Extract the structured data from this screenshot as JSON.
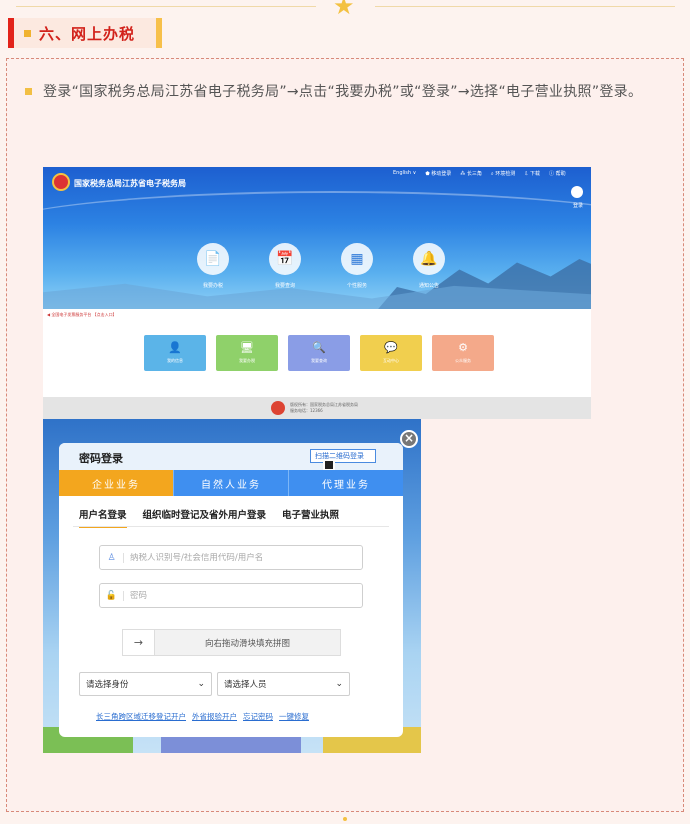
{
  "section": {
    "title": "六、网上办税"
  },
  "description": "登录“国家税务总局江苏省电子税务局”→点击“我要办税”或“登录”→选择“电子营业执照”登录。",
  "portal": {
    "site_title": "国家税务总局江苏省电子税务局",
    "top_nav": [
      "English ∨",
      "⬟ 移动登录",
      "⁂ 长三角",
      "⌕ 环境检测",
      "⇩ 下载",
      "ⓘ 帮助"
    ],
    "login_label": "登录",
    "circles": [
      {
        "icon": "📄",
        "label": "我要办税"
      },
      {
        "icon": "📅",
        "label": "我要查询"
      },
      {
        "icon": "▦",
        "label": "个性服务"
      },
      {
        "icon": "🔔",
        "label": "通知公告"
      }
    ],
    "notice": "◀ 全国电子发票服务平台 【点击入口】",
    "tiles": [
      {
        "icon": "👤",
        "label": "我的信息",
        "color": "#5bb4e8"
      },
      {
        "icon": "🖥",
        "label": "我要办税",
        "color": "#8fd16a"
      },
      {
        "icon": "🔍",
        "label": "我要查询",
        "color": "#8a9de6"
      },
      {
        "icon": "💬",
        "label": "互动中心",
        "color": "#f1cf4e"
      },
      {
        "icon": "⚙",
        "label": "公众服务",
        "color": "#f4a98a"
      }
    ],
    "footer": [
      "版权所有：国家税务总局江苏省税务局",
      "服务电话：12366"
    ]
  },
  "login": {
    "title": "密码登录",
    "qr_link": "扫描二维码登录",
    "close": "×",
    "tabs": [
      "企业业务",
      "自然人业务",
      "代理业务"
    ],
    "subtabs": [
      "用户名登录",
      "组织临时登记及省外用户登录",
      "电子营业执照"
    ],
    "username_placeholder": "纳税人识别号/社会信用代码/用户名",
    "password_placeholder": "密码",
    "slider_text": "向右拖动滑块填充拼图",
    "slider_arrow": "→",
    "select_identity": "请选择身份",
    "select_person": "请选择人员",
    "links": [
      "长三角跨区域迁移登记开户",
      "外省报验开户",
      "忘记密码",
      "一键修复"
    ]
  }
}
